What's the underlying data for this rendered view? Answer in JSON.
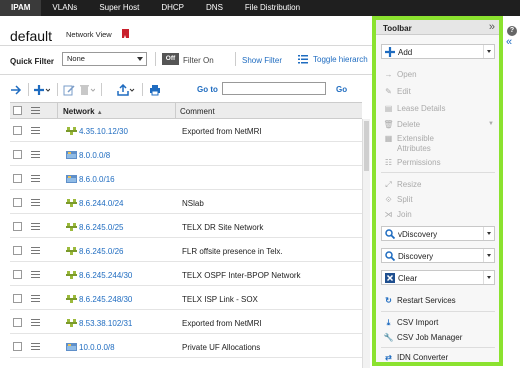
{
  "topnav": {
    "tabs": [
      "IPAM",
      "VLANs",
      "Super Host",
      "DHCP",
      "DNS",
      "File Distribution"
    ],
    "active": "IPAM"
  },
  "header": {
    "title": "default",
    "network_view_label": "Network View"
  },
  "filterbar": {
    "quick_filter_label": "Quick Filter",
    "quick_filter_value": "None",
    "toggle_state": "Off",
    "filter_on_label": "Filter On",
    "show_filter": "Show Filter",
    "toggle_hierarchy": "Toggle hierarch"
  },
  "actionbar": {
    "goto_label": "Go to",
    "goto_value": "",
    "go_button": "Go"
  },
  "grid": {
    "columns": [
      "Network",
      "Comment"
    ],
    "rows": [
      {
        "network": "4.35.10.12/30",
        "comment": "Exported from NetMRI",
        "icon": "network-icon"
      },
      {
        "network": "8.0.0.0/8",
        "comment": "",
        "icon": "container-icon"
      },
      {
        "network": "8.6.0.0/16",
        "comment": "",
        "icon": "container-icon"
      },
      {
        "network": "8.6.244.0/24",
        "comment": "NSlab",
        "icon": "network-icon"
      },
      {
        "network": "8.6.245.0/25",
        "comment": "TELX DR Site Network",
        "icon": "network-icon"
      },
      {
        "network": "8.6.245.0/26",
        "comment": "FLR offsite presence in Telx.",
        "icon": "network-icon"
      },
      {
        "network": "8.6.245.244/30",
        "comment": "TELX OSPF Inter-BPOP Network",
        "icon": "network-icon"
      },
      {
        "network": "8.6.245.248/30",
        "comment": "TELX ISP Link - SOX",
        "icon": "network-icon"
      },
      {
        "network": "8.53.38.102/31",
        "comment": "Exported from NetMRI",
        "icon": "network-icon"
      },
      {
        "network": "10.0.0.0/8",
        "comment": "Private UF Allocations",
        "icon": "container-icon"
      }
    ]
  },
  "toolbar": {
    "title": "Toolbar",
    "add": "Add",
    "open": "Open",
    "edit": "Edit",
    "lease_details": "Lease Details",
    "delete": "Delete",
    "extensible_attributes_1": "Extensible",
    "extensible_attributes_2": "Attributes",
    "permissions": "Permissions",
    "resize": "Resize",
    "split": "Split",
    "join": "Join",
    "vdiscovery": "vDiscovery",
    "discovery": "Discovery",
    "clear": "Clear",
    "restart_services": "Restart Services",
    "csv_import": "CSV Import",
    "csv_job_manager": "CSV Job Manager",
    "idn_converter": "IDN Converter"
  },
  "colors": {
    "accent": "#1f6cc0",
    "highlight": "#8be22f",
    "nav_bg": "#1f1f1f"
  }
}
